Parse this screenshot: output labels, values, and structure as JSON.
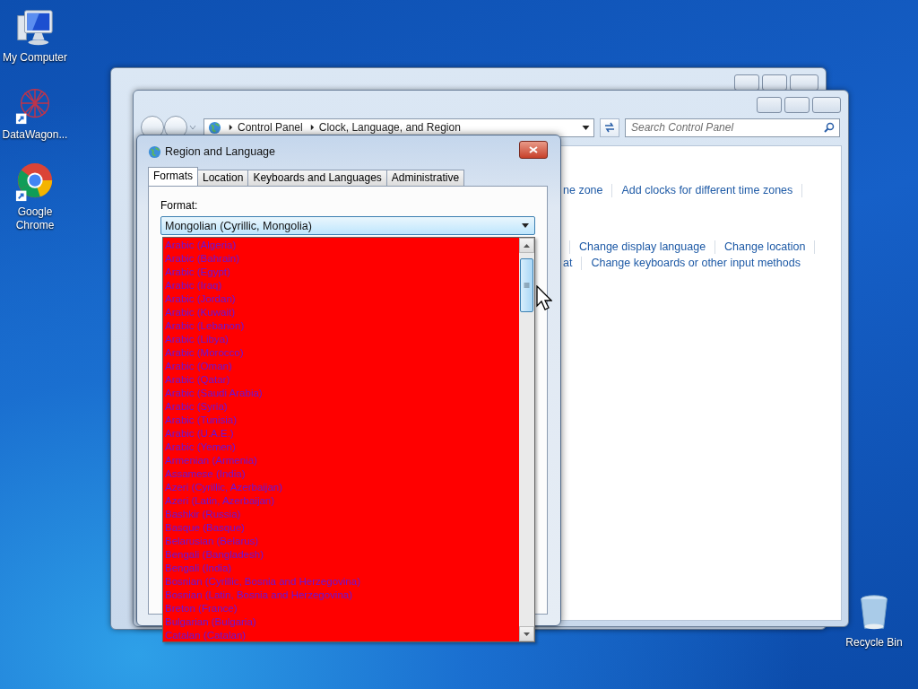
{
  "desktop_icons": [
    {
      "label": "My Computer",
      "kind": "computer"
    },
    {
      "label": "DataWagon...",
      "kind": "datawagon"
    },
    {
      "label": "Google Chrome",
      "kind": "chrome"
    }
  ],
  "recycle_bin": {
    "label": "Recycle Bin"
  },
  "control_panel": {
    "breadcrumb": [
      "Control Panel",
      "Clock, Language, and Region"
    ],
    "search": {
      "placeholder": "Search Control Panel"
    },
    "link_rows": [
      {
        "links": [
          "ne zone",
          "Add clocks for different time zones"
        ]
      },
      {
        "links": [
          "Change display language",
          "Change location"
        ]
      },
      {
        "links": [
          "at",
          "Change keyboards or other input methods"
        ]
      }
    ]
  },
  "dialog": {
    "title": "Region and Language",
    "tabs": [
      {
        "label": "Formats",
        "selected": true
      },
      {
        "label": "Location",
        "selected": false
      },
      {
        "label": "Keyboards and Languages",
        "selected": false
      },
      {
        "label": "Administrative",
        "selected": false
      }
    ],
    "format_label": "Format:",
    "format_value": "Mongolian (Cyrillic, Mongolia)",
    "dropdown_items": [
      "Arabic (Algeria)",
      "Arabic (Bahrain)",
      "Arabic (Egypt)",
      "Arabic (Iraq)",
      "Arabic (Jordan)",
      "Arabic (Kuwait)",
      "Arabic (Lebanon)",
      "Arabic (Libya)",
      "Arabic (Morocco)",
      "Arabic (Oman)",
      "Arabic (Qatar)",
      "Arabic (Saudi Arabia)",
      "Arabic (Syria)",
      "Arabic (Tunisia)",
      "Arabic (U.A.E.)",
      "Arabic (Yemen)",
      "Armenian (Armenia)",
      "Assamese (India)",
      "Azeri (Cyrillic, Azerbaijan)",
      "Azeri (Latin, Azerbaijan)",
      "Bashkir (Russia)",
      "Basque (Basque)",
      "Belarusian (Belarus)",
      "Bengali (Bangladesh)",
      "Bengali (India)",
      "Bosnian (Cyrillic, Bosnia and Herzegovina)",
      "Bosnian (Latin, Bosnia and Herzegovina)",
      "Breton (France)",
      "Bulgarian (Bulgaria)",
      "Catalan (Catalan)"
    ]
  }
}
